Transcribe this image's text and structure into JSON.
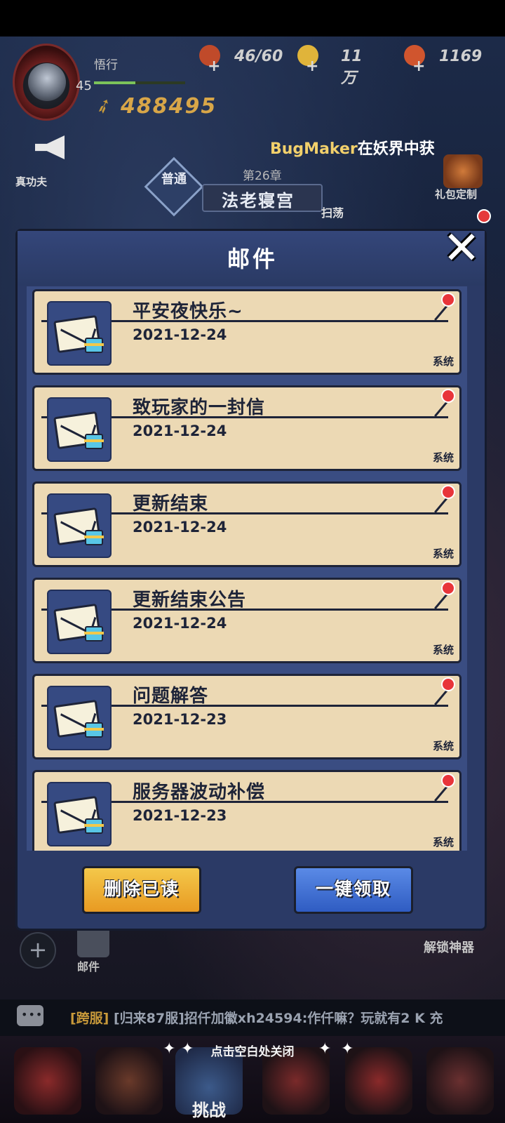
{
  "player": {
    "name": "悟行",
    "level": "45",
    "power": "488495",
    "exp_fraction": 0.45
  },
  "resources": [
    {
      "name": "stamina",
      "icon": "meat-icon",
      "value": "46/60",
      "color": "#c04a2a"
    },
    {
      "name": "gold",
      "icon": "coin-icon",
      "value": "11万",
      "color": "#e0b43a"
    },
    {
      "name": "gems",
      "icon": "gem-icon",
      "value": "1169",
      "color": "#d0552e"
    }
  ],
  "announcement": {
    "label": "真功夫",
    "broadcast_highlight": "BugMaker",
    "broadcast_rest": "在妖界中获"
  },
  "gift": {
    "label": "礼包定制"
  },
  "stage": {
    "chapter": "第26章",
    "mode": "普通",
    "name": "法老寝宫",
    "sweep": "扫荡"
  },
  "dialog": {
    "title": "邮件",
    "close_icon": "close-icon",
    "mails": [
      {
        "title": "平安夜快乐~",
        "date": "2021-12-24",
        "sender": "系统",
        "unread": true
      },
      {
        "title": "致玩家的一封信",
        "date": "2021-12-24",
        "sender": "系统",
        "unread": true
      },
      {
        "title": "更新结束",
        "date": "2021-12-24",
        "sender": "系统",
        "unread": true
      },
      {
        "title": "更新结束公告",
        "date": "2021-12-24",
        "sender": "系统",
        "unread": true
      },
      {
        "title": "问题解答",
        "date": "2021-12-23",
        "sender": "系统",
        "unread": true
      },
      {
        "title": "服务器波动补偿",
        "date": "2021-12-23",
        "sender": "系统",
        "unread": true
      }
    ],
    "delete_read_label": "删除已读",
    "claim_all_label": "一键领取"
  },
  "side": {
    "mail_label": "邮件",
    "unlock_label": "解锁神器"
  },
  "chat": {
    "tag": "[跨服]",
    "message": "[归来87服]招仟加徽xh24594:作仟嘛？玩就有2 K 充"
  },
  "close_hint": "点击空白处关闭",
  "nav": {
    "active_label": "挑战"
  },
  "colors": {
    "paper": "#ecd9b4",
    "dialog_blue": "#2b3a66",
    "unread_red": "#e8353a",
    "delete_orange": "#e89a22",
    "claim_blue": "#2f5cc2"
  }
}
